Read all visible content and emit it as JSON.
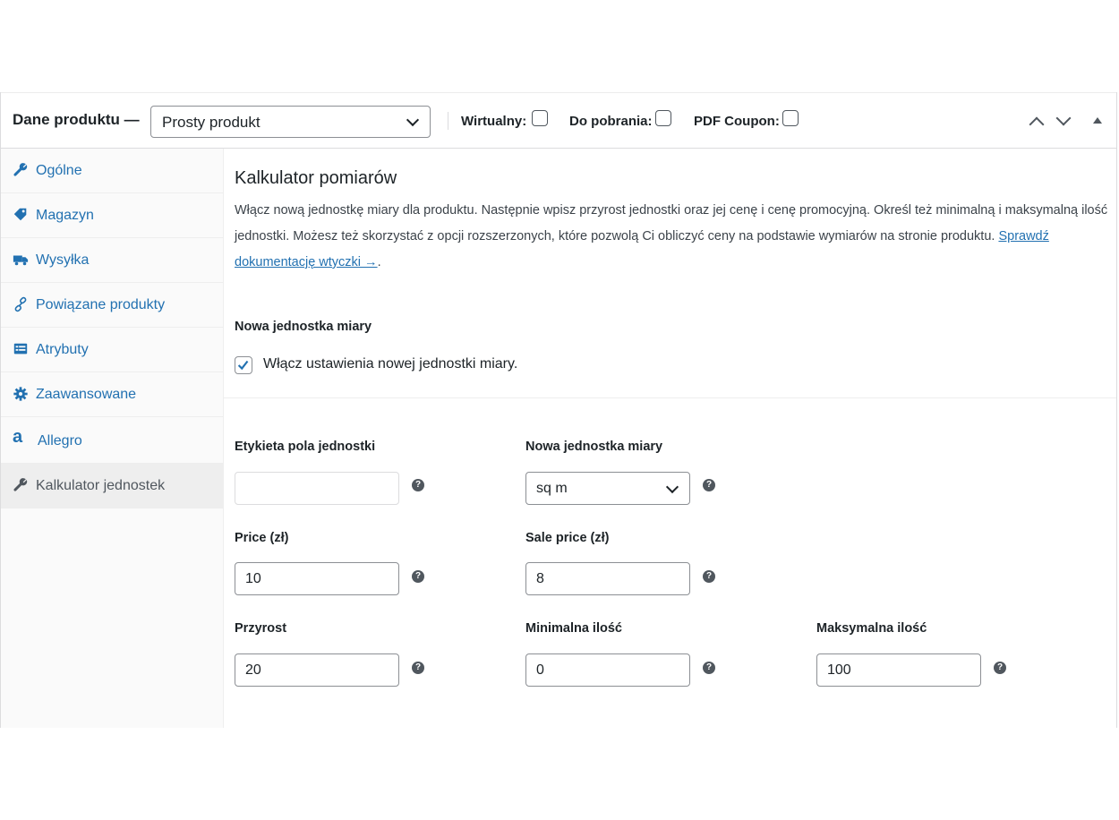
{
  "header": {
    "title": "Dane produktu —",
    "product_type": "Prosty produkt",
    "checkboxes": [
      {
        "label": "Wirtualny:",
        "checked": false
      },
      {
        "label": "Do pobrania:",
        "checked": false
      },
      {
        "label": "PDF Coupon:",
        "checked": false
      }
    ]
  },
  "sidebar": {
    "items": [
      {
        "label": "Ogólne",
        "icon": "wrench-icon"
      },
      {
        "label": "Magazyn",
        "icon": "tag-icon"
      },
      {
        "label": "Wysyłka",
        "icon": "truck-icon"
      },
      {
        "label": "Powiązane produkty",
        "icon": "link-icon"
      },
      {
        "label": "Atrybuty",
        "icon": "list-icon"
      },
      {
        "label": "Zaawansowane",
        "icon": "gear-icon"
      },
      {
        "label": "Allegro",
        "icon": "allegro-icon"
      },
      {
        "label": "Kalkulator jednostek",
        "icon": "wrench-icon",
        "active": true
      }
    ]
  },
  "main": {
    "title": "Kalkulator pomiarów",
    "description": "Włącz nową jednostkę miary dla produktu. Następnie wpisz przyrost jednostki oraz jej cenę i cenę promocyjną. Określ też minimalną i maksymalną ilość jednostki. Możesz też skorzystać z opcji rozszerzonych, które pozwolą Ci obliczyć ceny na podstawie wymiarów na stronie produktu.",
    "doc_link": "Sprawdź dokumentację wtyczki →",
    "doc_suffix": ".",
    "new_unit_section": "Nowa jednostka miary",
    "enable_checkbox": {
      "label": "Włącz ustawienia nowej jednostki miary.",
      "checked": true
    },
    "fields": {
      "unit_label": {
        "label": "Etykieta pola jednostki",
        "value": ""
      },
      "new_unit": {
        "label": "Nowa jednostka miary",
        "value": "sq m"
      },
      "price": {
        "label": "Price (zł)",
        "value": "10"
      },
      "sale_price": {
        "label": "Sale price (zł)",
        "value": "8"
      },
      "increment": {
        "label": "Przyrost",
        "value": "20"
      },
      "min_qty": {
        "label": "Minimalna ilość",
        "value": "0"
      },
      "max_qty": {
        "label": "Maksymalna ilość",
        "value": "100"
      }
    },
    "help_glyph": "?"
  },
  "colors": {
    "link": "#2271b1",
    "check": "#2271b1",
    "border": "#8c8f94"
  }
}
